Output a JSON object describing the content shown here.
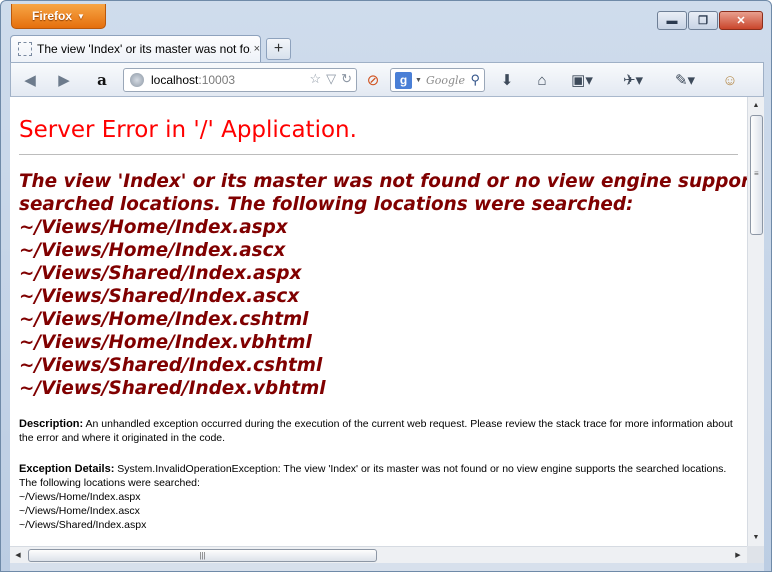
{
  "window": {
    "app_menu_label": "Firefox",
    "controls": {
      "minimize": "▬",
      "restore": "❐",
      "close": "✕"
    }
  },
  "tabs": [
    {
      "title": "The view 'Index' or its master was not fo...",
      "close": "×"
    }
  ],
  "new_tab_label": "+",
  "navbar": {
    "url_host": "localhost",
    "url_port": ":10003",
    "search_placeholder": "Google",
    "search_engine_letter": "g"
  },
  "page": {
    "title": "Server Error in '/' Application.",
    "error_message_lines": [
      "The view 'Index' or its master was not found or no view engine supports the",
      "searched locations. The following locations were searched:",
      "~/Views/Home/Index.aspx",
      "~/Views/Home/Index.ascx",
      "~/Views/Shared/Index.aspx",
      "~/Views/Shared/Index.ascx",
      "~/Views/Home/Index.cshtml",
      "~/Views/Home/Index.vbhtml",
      "~/Views/Shared/Index.cshtml",
      "~/Views/Shared/Index.vbhtml"
    ],
    "description_label": "Description:",
    "description_text": "An unhandled exception occurred during the execution of the current web request. Please review the stack trace for more information about the error and where it originated in the code.",
    "exception_label": "Exception Details:",
    "exception_text": "System.InvalidOperationException: The view 'Index' or its master was not found or no view engine supports the searched locations. The following locations were searched:",
    "exception_locations": [
      "~/Views/Home/Index.aspx",
      "~/Views/Home/Index.ascx",
      "~/Views/Shared/Index.aspx"
    ]
  },
  "colors": {
    "title_red": "#ff0000",
    "message_maroon": "#800000",
    "firefox_orange": "#e56f0d"
  },
  "icons": [
    "back-icon",
    "forward-icon",
    "amazon-icon",
    "globe-icon",
    "bookmark-star-icon",
    "dropmarker-icon",
    "reload-icon",
    "stop-icon",
    "google-icon",
    "search-icon",
    "downloads-icon",
    "home-icon",
    "bookmarks-icon",
    "tool-icon",
    "eyedropper-icon",
    "addon-face-icon"
  ]
}
